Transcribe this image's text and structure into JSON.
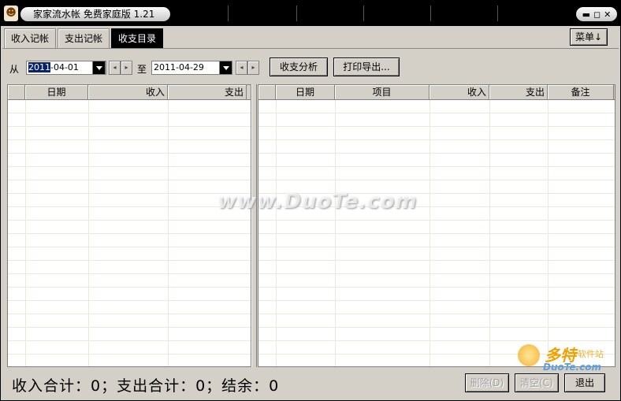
{
  "window": {
    "title": "家家流水帐   免费家庭版 1.21",
    "controls": {
      "minimize": "▬",
      "restore": "◻",
      "close": "✕"
    }
  },
  "tabs": [
    {
      "label": "收入记帐",
      "active": false
    },
    {
      "label": "支出记帐",
      "active": false
    },
    {
      "label": "收支目录",
      "active": true
    }
  ],
  "menu": {
    "label": "菜单↓"
  },
  "filter": {
    "from_label": "从",
    "from_date_sel": "2011",
    "from_date_rest": "-04-01",
    "to_label": "至",
    "to_date": "2011-04-29",
    "prev_arrow": "◂",
    "next_arrow": "▸",
    "analyze_button": "收支分析",
    "print_button": "打印导出..."
  },
  "left_table": {
    "columns": [
      "",
      "日期",
      "收入",
      "支出"
    ]
  },
  "right_table": {
    "columns": [
      "",
      "日期",
      "项目",
      "收入",
      "支出",
      "备注"
    ]
  },
  "summary": {
    "text": "收入合计：0；支出合计：0；结余：0"
  },
  "buttons": {
    "delete": "删除(D)",
    "clear": "清空(C)",
    "exit": "退出"
  },
  "watermark": "www.DuoTe.com",
  "logo": {
    "main": "多特",
    "sub": "软件站",
    "url": "DuoTe.com"
  },
  "colors": {
    "titlebar": "#000000",
    "window_bg": "#d4d0c8",
    "active_tab": "#000000",
    "selection": "#0a246a"
  }
}
